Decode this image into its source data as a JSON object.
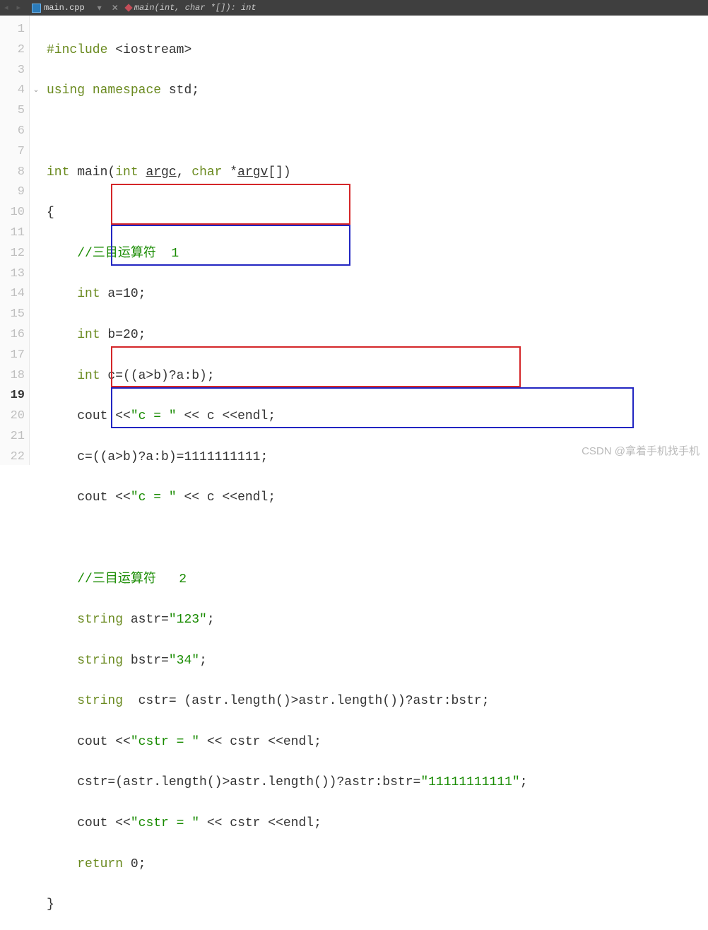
{
  "tabbar": {
    "filename": "main.cpp",
    "func_sig": "main(int, char *[]): int"
  },
  "lines": [
    "1",
    "2",
    "3",
    "4",
    "5",
    "6",
    "7",
    "8",
    "9",
    "10",
    "11",
    "12",
    "13",
    "14",
    "15",
    "16",
    "17",
    "18",
    "19",
    "20",
    "21",
    "22"
  ],
  "current_line": "19",
  "fold_line": "4",
  "code": {
    "l1_kw1": "#include",
    "l1_inc": " <iostream>",
    "l2_kw1": "using",
    "l2_kw2": "namespace",
    "l2_txt": " std;",
    "l4_kw1": "int",
    "l4_txt1": " main(",
    "l4_kw2": "int",
    "l4_argc": "argc",
    "l4_txt2": ", ",
    "l4_kw3": "char",
    "l4_txt3": " *",
    "l4_argv": "argv",
    "l4_txt4": "[])",
    "l5": "{",
    "l6_comment": "//三目运算符  1",
    "l7_kw": "int",
    "l7_txt": " a=10;",
    "l8_kw": "int",
    "l8_txt": " b=20;",
    "l9_kw": "int",
    "l9_txt": " c=((a>b)?a:b);",
    "l10_a": "cout <<",
    "l10_str": "\"c = \"",
    "l10_b": " << c <<endl;",
    "l11": "c=((a>b)?a:b)=1111111111;",
    "l12_a": "cout <<",
    "l12_str": "\"c = \"",
    "l12_b": " << c <<endl;",
    "l14_comment": "//三目运算符   2",
    "l15_kw": "string",
    "l15_a": " astr=",
    "l15_str": "\"123\"",
    "l15_b": ";",
    "l16_kw": "string",
    "l16_a": " bstr=",
    "l16_str": "\"34\"",
    "l16_b": ";",
    "l17_kw": "string",
    "l17_txt": "  cstr= (astr.length()>astr.length())?astr:bstr;",
    "l18_a": "cout <<",
    "l18_str": "\"cstr = \"",
    "l18_b": " << cstr <<endl;",
    "l19_a": "cstr=(astr.length()>astr.length())?astr:bstr=",
    "l19_str": "\"11111111111\"",
    "l19_b": ";",
    "l20_a": "cout <<",
    "l20_str": "\"cstr = \"",
    "l20_b": " << cstr <<endl;",
    "l21_kw": "return",
    "l21_txt": " 0;",
    "l22": "}"
  },
  "watermark": "CSDN @拿着手机找手机",
  "chart_data": null
}
